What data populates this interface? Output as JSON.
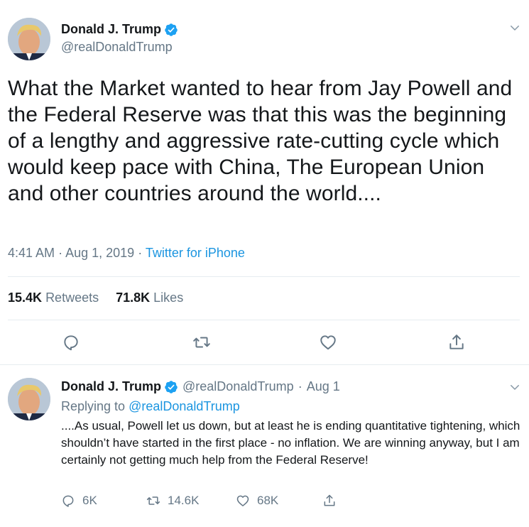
{
  "main_tweet": {
    "author_name": "Donald J. Trump",
    "author_handle": "@realDonaldTrump",
    "text": "What the Market wanted to hear from Jay Powell and the Federal Reserve was that this was the beginning of a lengthy and aggressive rate-cutting cycle which would keep pace with China, The European Union and other countries around the world....",
    "time": "4:41 AM",
    "date": "Aug 1, 2019",
    "separator": "·",
    "source": "Twitter for iPhone",
    "retweets_count": "15.4K",
    "retweets_label": "Retweets",
    "likes_count": "71.8K",
    "likes_label": "Likes",
    "actions": [
      "reply-icon",
      "retweet-icon",
      "like-icon",
      "share-icon"
    ]
  },
  "reply_tweet": {
    "author_name": "Donald J. Trump",
    "author_handle": "@realDonaldTrump",
    "separator": "·",
    "date": "Aug 1",
    "replying_label": "Replying to",
    "replying_to": "@realDonaldTrump",
    "text": "....As usual, Powell let us down, but at least he is ending quantitative tightening, which shouldn’t have started in the first place - no inflation. We are winning anyway, but I am certainly not getting much help from the Federal Reserve!",
    "reply_count": "6K",
    "retweet_count": "14.6K",
    "like_count": "68K"
  },
  "colors": {
    "text_primary": "#14171a",
    "text_secondary": "#657786",
    "link": "#1b95e0",
    "verified": "#1da1f2",
    "divider": "#e6ecf0"
  }
}
